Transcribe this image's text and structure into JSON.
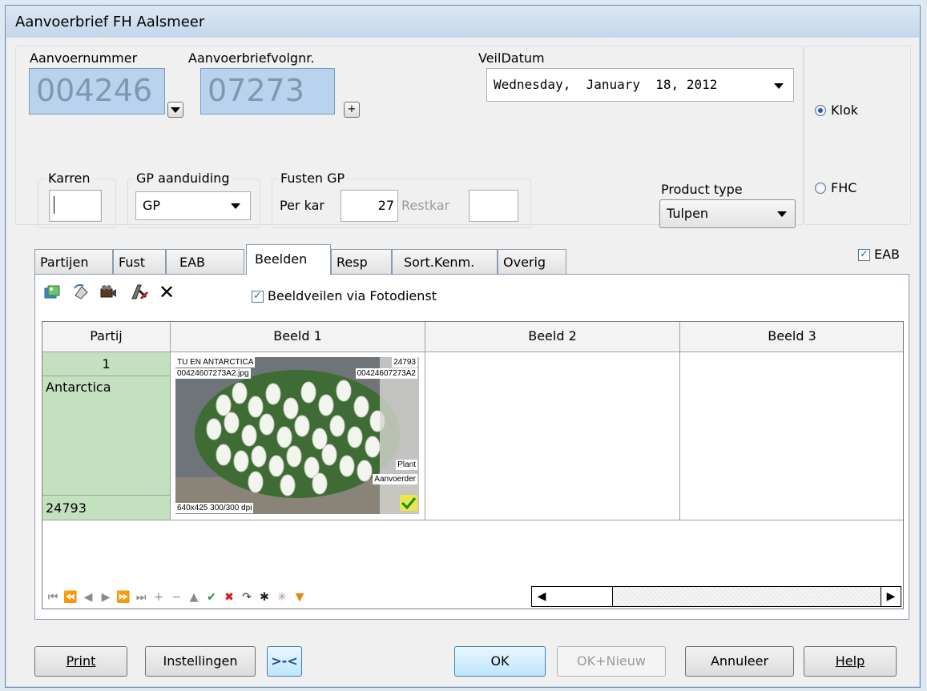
{
  "window": {
    "title": "Aanvoerbrief FH Aalsmeer"
  },
  "header": {
    "aanvoernummer_label": "Aanvoernummer",
    "aanvoernummer_value": "004246",
    "volgnr_label": "Aanvoerbriefvolgnr.",
    "volgnr_value": "07273",
    "plus_glyph": "+",
    "veildatum_label": "VeilDatum",
    "veildatum_value": "Wednesday,  January  18, 2012",
    "radio_klok": "Klok",
    "radio_fhc": "FHC",
    "karren_label": "Karren",
    "karren_value": "",
    "gp_label": "GP aanduiding",
    "gp_value": "GP",
    "fusten_label": "Fusten GP",
    "perkar_label": "Per kar",
    "perkar_value": "27",
    "restkar_label": "Restkar",
    "restkar_value": "",
    "product_type_label": "Product type",
    "product_type_value": "Tulpen",
    "eab_checkbox_label": "EAB"
  },
  "tabs": [
    "Partijen",
    "Fust",
    "EAB",
    "Beelden",
    "Resp",
    "Sort.Kenm.",
    "Overig"
  ],
  "active_tab": "Beelden",
  "toolbar": {
    "icons": [
      "import-image-icon",
      "rotate-image-icon",
      "camera-icon",
      "edit-image-icon",
      "delete-icon"
    ],
    "delete_glyph": "✕",
    "beeldveilen_label": "Beeldveilen via Fotodienst",
    "beeldveilen_checked": true
  },
  "grid": {
    "columns": [
      "Partij",
      "Beeld 1",
      "Beeld 2",
      "Beeld 3"
    ],
    "row": {
      "partij_nr": "1",
      "partij_name": "Antarctica",
      "partij_code": "24793",
      "photo_title": "TU EN ANTARCTICA",
      "photo_code": "24793",
      "photo_file": "00424607273A2.jpg",
      "photo_id": "00424607273A2",
      "photo_tag1": "Plant",
      "photo_tag2": "Aanvoerder",
      "photo_info": "640x425 300/300 dpi"
    }
  },
  "navigator": {
    "icons": [
      "first-icon",
      "prior-page-icon",
      "prior-icon",
      "next-icon",
      "next-page-icon",
      "last-icon",
      "insert-icon",
      "delete-icon",
      "edit-icon",
      "post-icon",
      "cancel-icon",
      "refresh-icon",
      "apply-filter-icon",
      "clear-filter-icon",
      "filter-icon"
    ],
    "glyphs": [
      "⏮",
      "⏪",
      "◀",
      "▶",
      "⏩",
      "⏭",
      "+",
      "−",
      "▲",
      "✔",
      "✖",
      "↷",
      "✱",
      "✳",
      "▼"
    ]
  },
  "buttons": {
    "print": "Print",
    "instellingen": "Instellingen",
    "swap": ">-<",
    "ok": "OK",
    "ok_nieuw": "OK+Nieuw",
    "annuleer": "Annuleer",
    "help": "Help"
  }
}
